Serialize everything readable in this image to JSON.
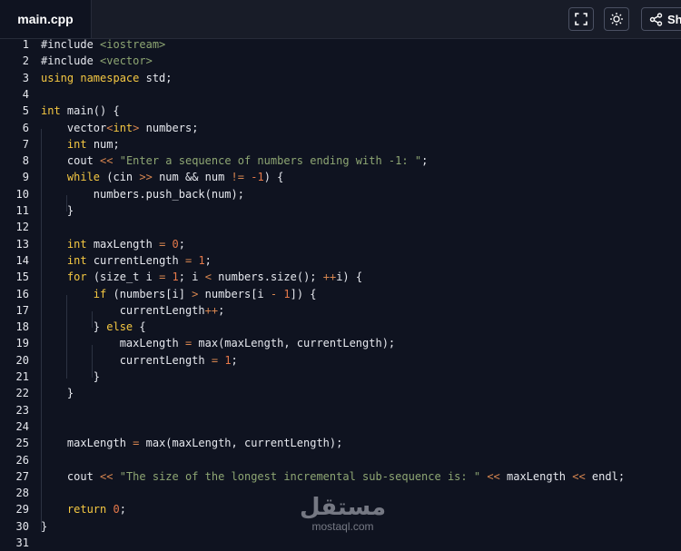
{
  "tab": {
    "filename": "main.cpp"
  },
  "toolbar": {
    "fullscreen_icon": "fullscreen-icon",
    "theme_icon": "sun-icon",
    "share_icon": "share-icon",
    "share_label": "Sh"
  },
  "colors": {
    "background": "#0f1320",
    "keyword": "#f5c842",
    "string": "#8ea673",
    "number": "#e7794a",
    "operator": "#d6854f",
    "text": "#e6e8ee"
  },
  "code": {
    "lines": [
      {
        "n": "1",
        "t": [
          {
            "c": "#include ",
            "k": ""
          },
          {
            "c": "<iostream>",
            "k": "inc"
          }
        ]
      },
      {
        "n": "2",
        "t": [
          {
            "c": "#include ",
            "k": ""
          },
          {
            "c": "<vector>",
            "k": "inc"
          }
        ]
      },
      {
        "n": "3",
        "t": [
          {
            "c": "using namespace",
            "k": "kw"
          },
          {
            "c": " std;",
            "k": ""
          }
        ]
      },
      {
        "n": "4",
        "t": []
      },
      {
        "n": "5",
        "t": [
          {
            "c": "int",
            "k": "kw"
          },
          {
            "c": " main() {",
            "k": ""
          }
        ]
      },
      {
        "n": "6",
        "t": [
          {
            "c": "    vector",
            "k": ""
          },
          {
            "c": "<",
            "k": "op"
          },
          {
            "c": "int",
            "k": "kw"
          },
          {
            "c": ">",
            "k": "op"
          },
          {
            "c": " numbers;",
            "k": ""
          }
        ]
      },
      {
        "n": "7",
        "t": [
          {
            "c": "    ",
            "k": ""
          },
          {
            "c": "int",
            "k": "kw"
          },
          {
            "c": " num;",
            "k": ""
          }
        ]
      },
      {
        "n": "8",
        "t": [
          {
            "c": "    cout ",
            "k": ""
          },
          {
            "c": "<<",
            "k": "op"
          },
          {
            "c": " ",
            "k": ""
          },
          {
            "c": "\"Enter a sequence of numbers ending with -1: \"",
            "k": "str"
          },
          {
            "c": ";",
            "k": ""
          }
        ]
      },
      {
        "n": "9",
        "t": [
          {
            "c": "    ",
            "k": ""
          },
          {
            "c": "while",
            "k": "kw"
          },
          {
            "c": " (cin ",
            "k": ""
          },
          {
            "c": ">>",
            "k": "op"
          },
          {
            "c": " num && num ",
            "k": ""
          },
          {
            "c": "!=",
            "k": "op"
          },
          {
            "c": " ",
            "k": ""
          },
          {
            "c": "-1",
            "k": "num"
          },
          {
            "c": ") {",
            "k": ""
          }
        ]
      },
      {
        "n": "10",
        "t": [
          {
            "c": "        numbers.push_back(num);",
            "k": ""
          }
        ]
      },
      {
        "n": "11",
        "t": [
          {
            "c": "    }",
            "k": ""
          }
        ]
      },
      {
        "n": "12",
        "t": []
      },
      {
        "n": "13",
        "t": [
          {
            "c": "    ",
            "k": ""
          },
          {
            "c": "int",
            "k": "kw"
          },
          {
            "c": " maxLength ",
            "k": ""
          },
          {
            "c": "=",
            "k": "op"
          },
          {
            "c": " ",
            "k": ""
          },
          {
            "c": "0",
            "k": "num"
          },
          {
            "c": ";",
            "k": ""
          }
        ]
      },
      {
        "n": "14",
        "t": [
          {
            "c": "    ",
            "k": ""
          },
          {
            "c": "int",
            "k": "kw"
          },
          {
            "c": " currentLength ",
            "k": ""
          },
          {
            "c": "=",
            "k": "op"
          },
          {
            "c": " ",
            "k": ""
          },
          {
            "c": "1",
            "k": "num"
          },
          {
            "c": ";",
            "k": ""
          }
        ]
      },
      {
        "n": "15",
        "t": [
          {
            "c": "    ",
            "k": ""
          },
          {
            "c": "for",
            "k": "kw"
          },
          {
            "c": " (size_t i ",
            "k": ""
          },
          {
            "c": "=",
            "k": "op"
          },
          {
            "c": " ",
            "k": ""
          },
          {
            "c": "1",
            "k": "num"
          },
          {
            "c": "; i ",
            "k": ""
          },
          {
            "c": "<",
            "k": "op"
          },
          {
            "c": " numbers.size(); ",
            "k": ""
          },
          {
            "c": "++",
            "k": "op"
          },
          {
            "c": "i) {",
            "k": ""
          }
        ]
      },
      {
        "n": "16",
        "t": [
          {
            "c": "        ",
            "k": ""
          },
          {
            "c": "if",
            "k": "kw"
          },
          {
            "c": " (numbers[i] ",
            "k": ""
          },
          {
            "c": ">",
            "k": "op"
          },
          {
            "c": " numbers[i ",
            "k": ""
          },
          {
            "c": "-",
            "k": "op"
          },
          {
            "c": " ",
            "k": ""
          },
          {
            "c": "1",
            "k": "num"
          },
          {
            "c": "]) {",
            "k": ""
          }
        ]
      },
      {
        "n": "17",
        "t": [
          {
            "c": "            currentLength",
            "k": ""
          },
          {
            "c": "++",
            "k": "op"
          },
          {
            "c": ";",
            "k": ""
          }
        ]
      },
      {
        "n": "18",
        "t": [
          {
            "c": "        } ",
            "k": ""
          },
          {
            "c": "else",
            "k": "kw"
          },
          {
            "c": " {",
            "k": ""
          }
        ]
      },
      {
        "n": "19",
        "t": [
          {
            "c": "            maxLength ",
            "k": ""
          },
          {
            "c": "=",
            "k": "op"
          },
          {
            "c": " max(maxLength, currentLength);",
            "k": ""
          }
        ]
      },
      {
        "n": "20",
        "t": [
          {
            "c": "            currentLength ",
            "k": ""
          },
          {
            "c": "=",
            "k": "op"
          },
          {
            "c": " ",
            "k": ""
          },
          {
            "c": "1",
            "k": "num"
          },
          {
            "c": ";",
            "k": ""
          }
        ]
      },
      {
        "n": "21",
        "t": [
          {
            "c": "        }",
            "k": ""
          }
        ]
      },
      {
        "n": "22",
        "t": [
          {
            "c": "    }",
            "k": ""
          }
        ]
      },
      {
        "n": "23",
        "t": []
      },
      {
        "n": "24",
        "t": []
      },
      {
        "n": "25",
        "t": [
          {
            "c": "    maxLength ",
            "k": ""
          },
          {
            "c": "=",
            "k": "op"
          },
          {
            "c": " max(maxLength, currentLength);",
            "k": ""
          }
        ]
      },
      {
        "n": "26",
        "t": []
      },
      {
        "n": "27",
        "t": [
          {
            "c": "    cout ",
            "k": ""
          },
          {
            "c": "<<",
            "k": "op"
          },
          {
            "c": " ",
            "k": ""
          },
          {
            "c": "\"The size of the longest incremental sub-sequence is: \"",
            "k": "str"
          },
          {
            "c": " ",
            "k": ""
          },
          {
            "c": "<<",
            "k": "op"
          },
          {
            "c": " maxLength ",
            "k": ""
          },
          {
            "c": "<<",
            "k": "op"
          },
          {
            "c": " endl;",
            "k": ""
          }
        ]
      },
      {
        "n": "28",
        "t": []
      },
      {
        "n": "29",
        "t": [
          {
            "c": "    ",
            "k": ""
          },
          {
            "c": "return",
            "k": "kw"
          },
          {
            "c": " ",
            "k": ""
          },
          {
            "c": "0",
            "k": "num"
          },
          {
            "c": ";",
            "k": ""
          }
        ]
      },
      {
        "n": "30",
        "t": [
          {
            "c": "}",
            "k": ""
          }
        ]
      },
      {
        "n": "31",
        "t": []
      }
    ]
  },
  "watermark": {
    "arabic": "مستقل",
    "latin": "mostaql.com"
  }
}
